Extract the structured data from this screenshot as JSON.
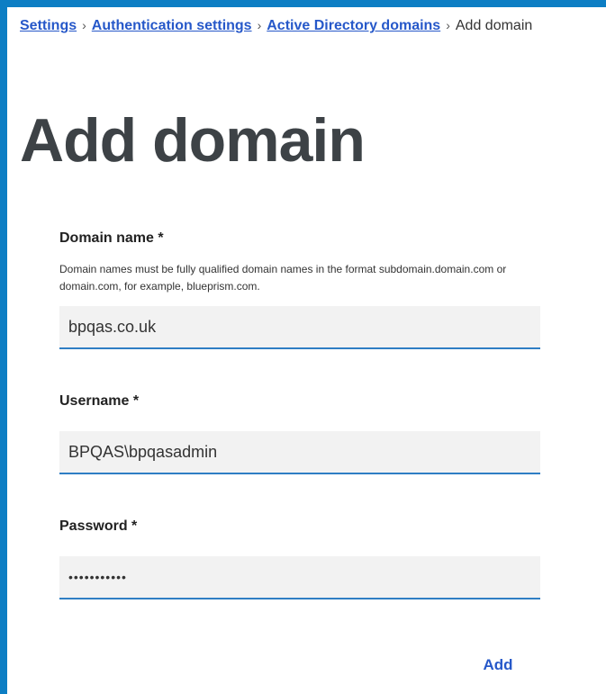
{
  "breadcrumb": {
    "items": [
      "Settings",
      "Authentication settings",
      "Active Directory domains"
    ],
    "separator": "›",
    "current": "Add domain"
  },
  "page": {
    "title": "Add domain"
  },
  "form": {
    "domain_name": {
      "label": "Domain name *",
      "help": "Domain names must be fully qualified domain names in the format subdomain.domain.com or domain.com, for example, blueprism.com.",
      "value": "bpqas.co.uk"
    },
    "username": {
      "label": "Username *",
      "value": "BPQAS\\bpqasadmin"
    },
    "password": {
      "label": "Password *",
      "value": "•••••••••••"
    },
    "add_label": "Add"
  },
  "colors": {
    "frame": "#0d7ec4",
    "link": "#2658c9",
    "input_underline": "#2f7ec4",
    "input_bg": "#f2f2f2"
  }
}
